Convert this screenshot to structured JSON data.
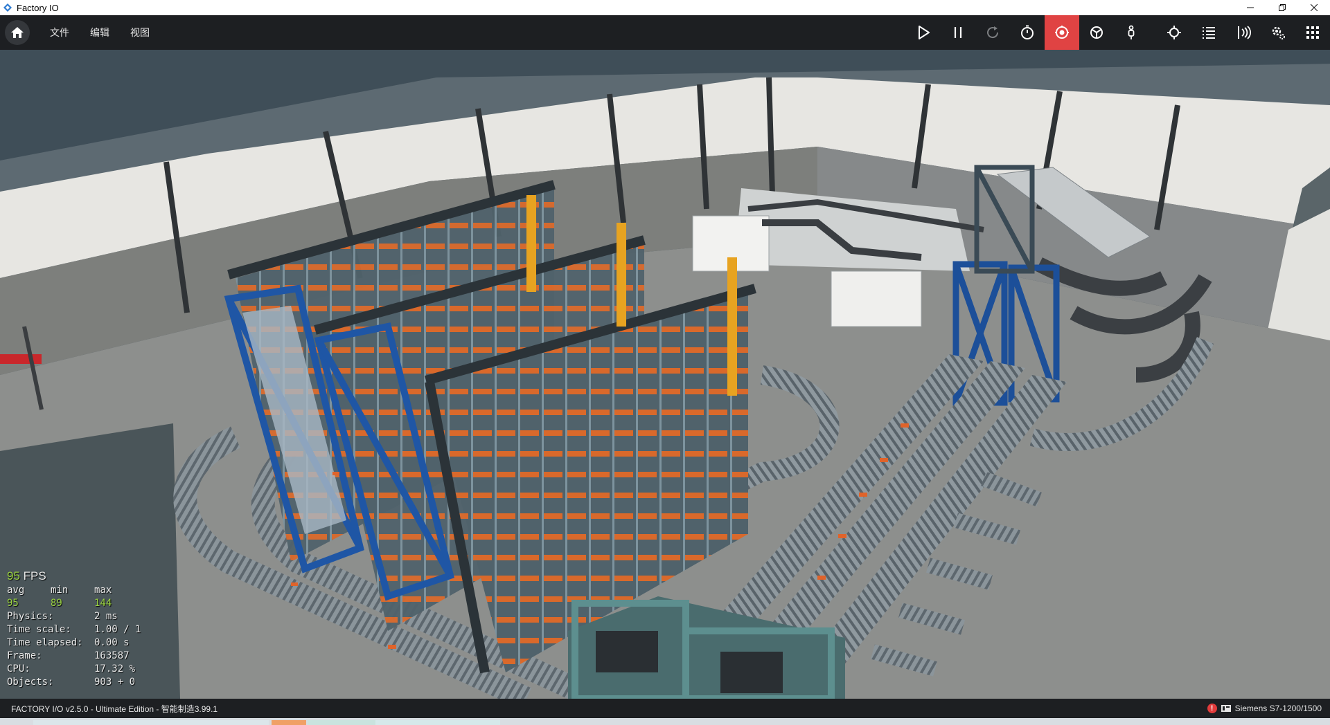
{
  "window": {
    "title": "Factory IO",
    "controls": [
      "minimize-icon",
      "restore-icon",
      "close-icon"
    ]
  },
  "menu": {
    "items": [
      "文件",
      "编辑",
      "视图"
    ]
  },
  "toolbar": {
    "tools": [
      {
        "name": "play-icon"
      },
      {
        "name": "pause-icon"
      },
      {
        "name": "reset-icon"
      },
      {
        "name": "timer-icon"
      },
      {
        "name": "camera-orbit-icon",
        "active": true
      },
      {
        "name": "fly-camera-icon"
      },
      {
        "name": "first-person-icon"
      },
      {
        "name": "crosshair-icon"
      },
      {
        "name": "list-icon"
      },
      {
        "name": "sensor-icon"
      },
      {
        "name": "settings-icon"
      },
      {
        "name": "grid-icon"
      }
    ],
    "active_color": "#e04343"
  },
  "stats": {
    "fps": "95",
    "fps_unit": "FPS",
    "header": {
      "avg": "avg",
      "min": "min",
      "max": "max"
    },
    "values": {
      "avg": "95",
      "min": "89",
      "max": "144"
    },
    "rows": [
      {
        "label": "Physics:",
        "value": "2 ms"
      },
      {
        "label": "Time scale:",
        "value": "1.00 / 1"
      },
      {
        "label": "Time elapsed:",
        "value": "0.00 s"
      },
      {
        "label": "Frame:",
        "value": "163587"
      },
      {
        "label": "CPU:",
        "value": "17.32 %"
      },
      {
        "label": "Objects:",
        "value": "903 + 0"
      }
    ]
  },
  "statusbar": {
    "left": "FACTORY I/O v2.5.0 - Ultimate Edition - 智能制造3.99.1",
    "alert": "!",
    "driver": "Siemens S7-1200/1500"
  }
}
